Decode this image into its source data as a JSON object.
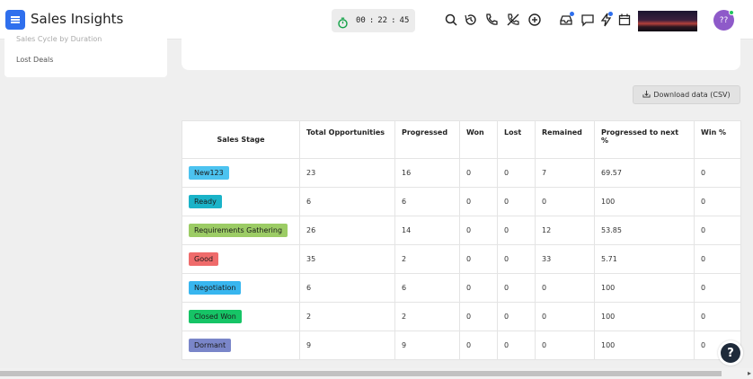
{
  "header": {
    "title": "Sales Insights",
    "timer": {
      "hours": "00",
      "sep1": ":",
      "minutes": "22",
      "sep2": ":",
      "seconds": "45"
    },
    "icons": [
      "search-icon",
      "history-icon",
      "phone-icon",
      "mute-icon",
      "add-circle-icon",
      "inbox-icon",
      "chat-icon",
      "flash-icon",
      "calendar-icon"
    ],
    "avatar_initials": "??",
    "colors": {
      "accent": "#2f6fed",
      "timer_icon": "#16a34a",
      "avatar": "#8e5ac9",
      "notification_dot": "#2f6fed"
    }
  },
  "sidebar": {
    "items": [
      {
        "label": "Sales Cycle by Duration"
      },
      {
        "label": "Lost Deals"
      }
    ]
  },
  "download_button": {
    "label": "Download data (CSV)",
    "icon": "download-icon"
  },
  "table": {
    "headers": [
      "Sales Stage",
      "Total Opportunities",
      "Progressed",
      "Won",
      "Lost",
      "Remained",
      "Progressed to next %",
      "Win %"
    ],
    "rows": [
      {
        "stage": "New123",
        "color": "#4cc3f0",
        "total": "23",
        "progressed": "16",
        "won": "0",
        "lost": "0",
        "remained": "7",
        "progressed_pct": "69.57",
        "win_pct": "0"
      },
      {
        "stage": "Ready",
        "color": "#1ab3c8",
        "total": "6",
        "progressed": "6",
        "won": "0",
        "lost": "0",
        "remained": "0",
        "progressed_pct": "100",
        "win_pct": "0"
      },
      {
        "stage": "Requirements Gathering",
        "color": "#9ccc65",
        "total": "26",
        "progressed": "14",
        "won": "0",
        "lost": "0",
        "remained": "12",
        "progressed_pct": "53.85",
        "win_pct": "0"
      },
      {
        "stage": "Good",
        "color": "#ef6b6b",
        "total": "35",
        "progressed": "2",
        "won": "0",
        "lost": "0",
        "remained": "33",
        "progressed_pct": "5.71",
        "win_pct": "0"
      },
      {
        "stage": "Negotiation",
        "color": "#38b6ef",
        "total": "6",
        "progressed": "6",
        "won": "0",
        "lost": "0",
        "remained": "0",
        "progressed_pct": "100",
        "win_pct": "0"
      },
      {
        "stage": "Closed Won",
        "color": "#16c466",
        "total": "2",
        "progressed": "2",
        "won": "0",
        "lost": "0",
        "remained": "0",
        "progressed_pct": "100",
        "win_pct": "0"
      },
      {
        "stage": "Dormant",
        "color": "#7a86c9",
        "total": "9",
        "progressed": "9",
        "won": "0",
        "lost": "0",
        "remained": "0",
        "progressed_pct": "100",
        "win_pct": "0"
      }
    ]
  },
  "help": {
    "label": "?"
  }
}
